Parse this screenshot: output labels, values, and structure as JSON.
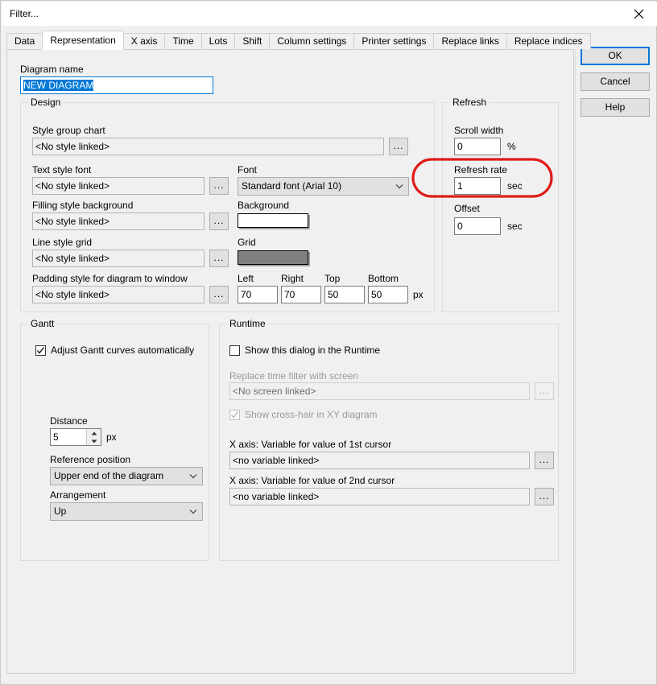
{
  "window": {
    "title": "Filter...",
    "close_icon": "close-icon"
  },
  "tabs": [
    {
      "label": "Data",
      "active": false
    },
    {
      "label": "Representation",
      "active": true
    },
    {
      "label": "X axis",
      "active": false
    },
    {
      "label": "Time",
      "active": false
    },
    {
      "label": "Lots",
      "active": false
    },
    {
      "label": "Shift",
      "active": false
    },
    {
      "label": "Column settings",
      "active": false
    },
    {
      "label": "Printer settings",
      "active": false
    },
    {
      "label": "Replace links",
      "active": false
    },
    {
      "label": "Replace indices",
      "active": false
    }
  ],
  "buttons": {
    "ok": "OK",
    "cancel": "Cancel",
    "help": "Help"
  },
  "diagram_name": {
    "label": "Diagram name",
    "value": "NEW DIAGRAM"
  },
  "design": {
    "title": "Design",
    "style_group_chart": {
      "label": "Style group chart",
      "value": "<No style linked>"
    },
    "text_style_font": {
      "label": "Text style font",
      "value": "<No style linked>",
      "browse": "..."
    },
    "filling_style_background": {
      "label": "Filling style background",
      "value": "<No style linked>",
      "browse": "..."
    },
    "line_style_grid": {
      "label": "Line style grid",
      "value": "<No style linked>",
      "browse": "..."
    },
    "padding_style": {
      "label": "Padding style for diagram to window",
      "value": "<No style linked>",
      "browse": "..."
    },
    "font": {
      "label": "Font",
      "value": "Standard font (Arial 10)"
    },
    "background": {
      "label": "Background",
      "color": "#ffffff"
    },
    "grid": {
      "label": "Grid",
      "color": "#808080"
    },
    "padding": {
      "left_label": "Left",
      "left_value": "70",
      "right_label": "Right",
      "right_value": "70",
      "top_label": "Top",
      "top_value": "50",
      "bottom_label": "Bottom",
      "bottom_value": "50",
      "unit": "px"
    }
  },
  "refresh": {
    "title": "Refresh",
    "scroll_width": {
      "label": "Scroll width",
      "value": "0",
      "unit": "%"
    },
    "refresh_rate": {
      "label": "Refresh rate",
      "value": "1",
      "unit": "sec"
    },
    "offset": {
      "label": "Offset",
      "value": "0",
      "unit": "sec"
    }
  },
  "gantt": {
    "title": "Gantt",
    "adjust_curves": {
      "label": "Adjust Gantt curves automatically",
      "checked": true
    },
    "distance": {
      "label": "Distance",
      "value": "5",
      "unit": "px"
    },
    "reference_position": {
      "label": "Reference position",
      "value": "Upper end of the diagram"
    },
    "arrangement": {
      "label": "Arrangement",
      "value": "Up"
    }
  },
  "runtime": {
    "title": "Runtime",
    "show_dialog": {
      "label": "Show this dialog in the Runtime",
      "checked": false
    },
    "replace_time_filter": {
      "label": "Replace time filter with screen",
      "value": "<No screen linked>",
      "browse": "..."
    },
    "show_crosshair": {
      "label": "Show cross-hair in XY diagram",
      "checked": true
    },
    "cursor1": {
      "label": "X axis: Variable for value of 1st cursor",
      "value": "<no variable linked>",
      "browse": "..."
    },
    "cursor2": {
      "label": "X axis: Variable for value of 2nd cursor",
      "value": "<no variable linked>",
      "browse": "..."
    }
  },
  "annotation": {
    "name": "red-ellipse-highlight",
    "color": "#e01b1b",
    "target": "Refresh rate"
  }
}
